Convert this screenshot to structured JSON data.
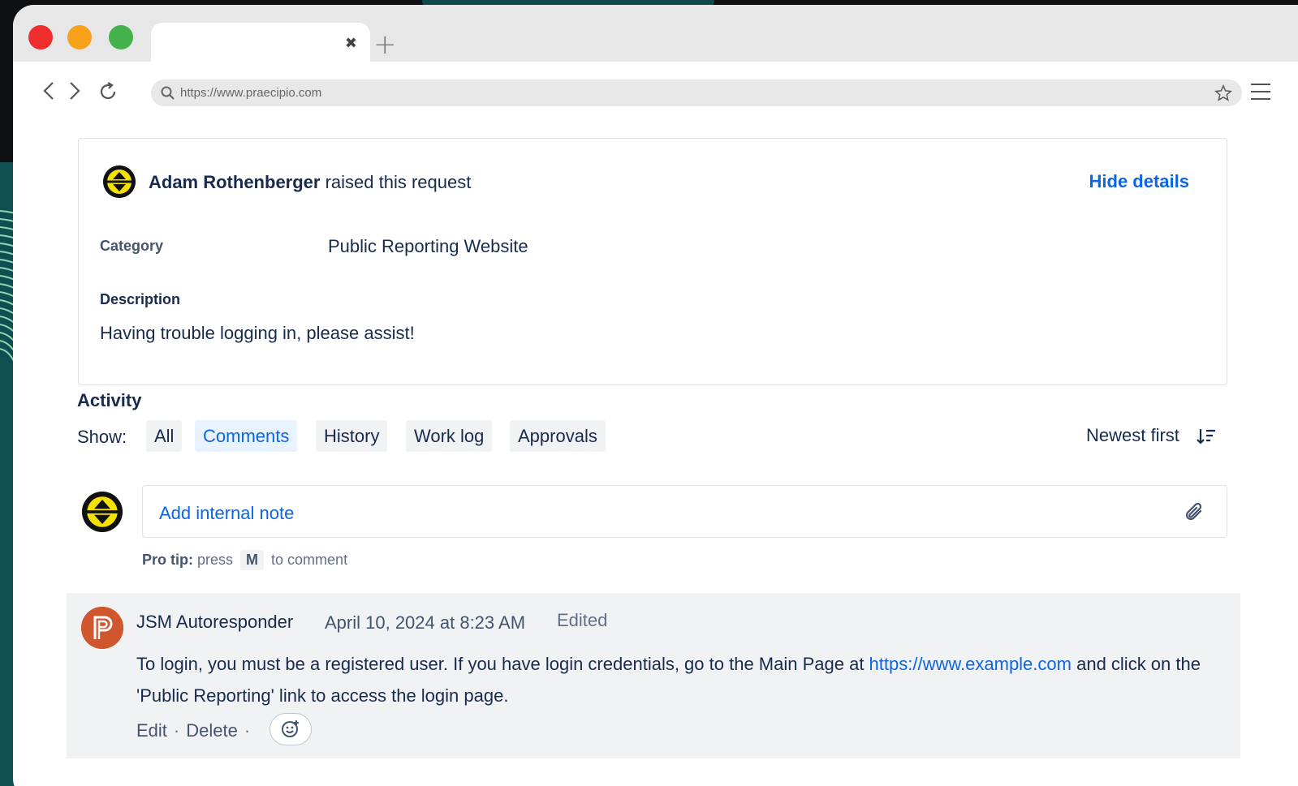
{
  "browser": {
    "tab_close": "✖",
    "new_tab": "+",
    "url": "https://www.praecipio.com"
  },
  "request": {
    "requester": "Adam Rothenberger",
    "raised_text": " raised this request",
    "hide_details": "Hide details",
    "category_label": "Category",
    "category_value": "Public Reporting Website",
    "description_label": "Description",
    "description_value": "Having trouble logging in, please assist!"
  },
  "activity": {
    "title": "Activity",
    "show_label": "Show:",
    "filters": [
      "All",
      "Comments",
      "History",
      "Work log",
      "Approvals"
    ],
    "active_filter": "Comments",
    "sort_label": "Newest first"
  },
  "note": {
    "placeholder": "Add internal note",
    "protip_label": "Pro tip:",
    "protip_press": " press ",
    "protip_key": "M",
    "protip_rest": " to comment"
  },
  "comment": {
    "author": "JSM Autoresponder",
    "date": "April 10, 2024 at 8:23 AM",
    "edited": "Edited",
    "body_before": "To login, you must be a registered user. If you have login credentials, go to the Main Page at ",
    "body_link": "https://www.example.com",
    "body_after": " and click on the 'Public Reporting' link to access the login page.",
    "edit": "Edit",
    "delete": "Delete",
    "sep": "·"
  },
  "colors": {
    "link_blue": "#0c66e4",
    "text_primary": "#172b4d",
    "comment_bg": "#f1f2f4",
    "avatar_accent": "#f5e100",
    "jsm_avatar": "#d0562d"
  },
  "icons": [
    "back-icon",
    "forward-icon",
    "reload-icon",
    "search-icon",
    "star-icon",
    "menu-icon",
    "sort-icon",
    "paperclip-icon",
    "emoji-icon"
  ]
}
